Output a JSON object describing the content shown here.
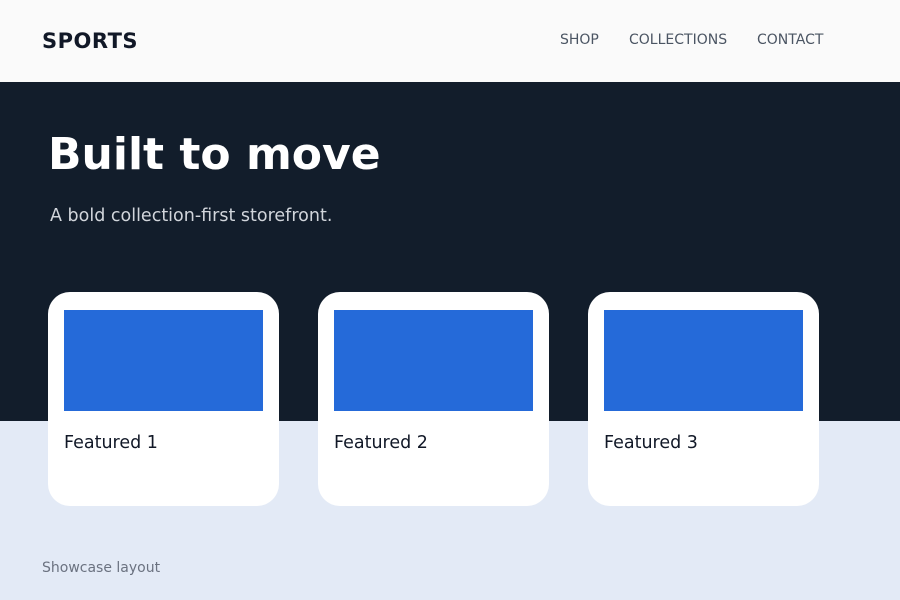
{
  "header": {
    "brand": "SPORTS",
    "nav": [
      "SHOP",
      "COLLECTIONS",
      "CONTACT"
    ]
  },
  "hero": {
    "title": "Built to move",
    "subtitle": "A bold collection-first storefront."
  },
  "featured": {
    "cards": [
      {
        "label": "Featured 1"
      },
      {
        "label": "Featured 2"
      },
      {
        "label": "Featured 3"
      }
    ]
  },
  "footer": {
    "note": "Showcase layout"
  },
  "colors": {
    "hero_background": "#121d2b",
    "header_background": "#fafafa",
    "page_background": "#e3eaf6",
    "card_image": "#256ad9"
  }
}
